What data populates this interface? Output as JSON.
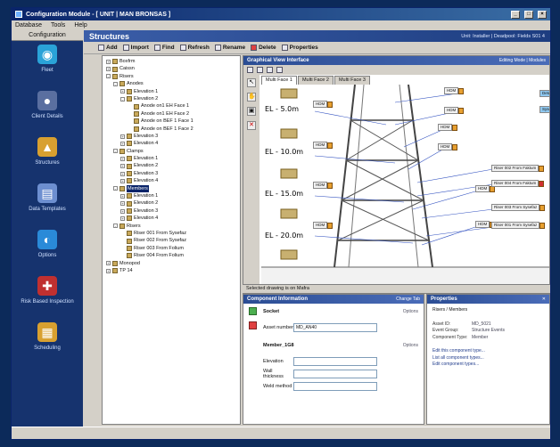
{
  "window": {
    "title": "Configuration Module - [ UNIT | MAN BRONSAS ]",
    "controls": [
      "_",
      "□",
      "×"
    ]
  },
  "menu": [
    "Database",
    "Tools",
    "Help"
  ],
  "nav": {
    "header": "Configuration",
    "items": [
      {
        "label": "Fleet",
        "icon": "globe-icon",
        "color": "#2aa3d8",
        "glyph": "◉"
      },
      {
        "label": "Client Details",
        "icon": "person-icon",
        "color": "#5a6fa0",
        "glyph": "●"
      },
      {
        "label": "Structures",
        "icon": "platform-icon",
        "color": "#d8a030",
        "glyph": "▲"
      },
      {
        "label": "Data Templates",
        "icon": "document-icon",
        "color": "#6d8fd0",
        "glyph": "▤"
      },
      {
        "label": "Options",
        "icon": "options-icon",
        "color": "#2a8ad8",
        "glyph": "◐"
      },
      {
        "label": "Risk Based Inspection",
        "icon": "risk-icon",
        "color": "#c03030",
        "glyph": "✚"
      },
      {
        "label": "Scheduling",
        "icon": "calendar-icon",
        "color": "#d8a030",
        "glyph": "▦"
      }
    ]
  },
  "structures": {
    "title": "Structures",
    "meta": "Unit: Installer | Deadpool: Fields S01 4"
  },
  "toolbar": [
    "Add",
    "Import",
    "Find",
    "Refresh",
    "Rename",
    "Delete",
    "Properties"
  ],
  "tree": [
    {
      "indent": 0,
      "box": "+",
      "label": "Boxfrm"
    },
    {
      "indent": 0,
      "box": "+",
      "label": "Caissn"
    },
    {
      "indent": 0,
      "box": "-",
      "label": "Risers"
    },
    {
      "indent": 1,
      "box": "-",
      "label": "Anodes"
    },
    {
      "indent": 2,
      "box": "+",
      "label": "Elevation 1"
    },
    {
      "indent": 2,
      "box": "-",
      "label": "Elevation 2"
    },
    {
      "indent": 3,
      "box": "",
      "label": "Anode on1 EH Face 1"
    },
    {
      "indent": 3,
      "box": "",
      "label": "Anode on1 EH Face 2"
    },
    {
      "indent": 3,
      "box": "",
      "label": "Anode on BEF 1 Face 1"
    },
    {
      "indent": 3,
      "box": "",
      "label": "Anode on BEF 1 Face 2"
    },
    {
      "indent": 2,
      "box": "+",
      "label": "Elevation 3"
    },
    {
      "indent": 2,
      "box": "+",
      "label": "Elevation 4"
    },
    {
      "indent": 1,
      "box": "-",
      "label": "Clamps"
    },
    {
      "indent": 2,
      "box": "+",
      "label": "Elevation 1"
    },
    {
      "indent": 2,
      "box": "+",
      "label": "Elevation 2"
    },
    {
      "indent": 2,
      "box": "+",
      "label": "Elevation 3"
    },
    {
      "indent": 2,
      "box": "+",
      "label": "Elevation 4"
    },
    {
      "indent": 1,
      "box": "-",
      "label": "Members",
      "selected": true
    },
    {
      "indent": 2,
      "box": "+",
      "label": "Elevation 1"
    },
    {
      "indent": 2,
      "box": "+",
      "label": "Elevation 2"
    },
    {
      "indent": 2,
      "box": "+",
      "label": "Elevation 3"
    },
    {
      "indent": 2,
      "box": "+",
      "label": "Elevation 4"
    },
    {
      "indent": 1,
      "box": "-",
      "label": "Risers"
    },
    {
      "indent": 2,
      "box": "",
      "label": "Riser 001 From Sysefaz"
    },
    {
      "indent": 2,
      "box": "",
      "label": "Riser 002 From Sysefaz"
    },
    {
      "indent": 2,
      "box": "",
      "label": "Riser 003 From Folium"
    },
    {
      "indent": 2,
      "box": "",
      "label": "Riser 004 From Folium"
    },
    {
      "indent": 0,
      "box": "+",
      "label": "Monopod"
    },
    {
      "indent": 0,
      "box": "+",
      "label": "TP 14"
    }
  ],
  "graphic": {
    "title": "Graphical View Interface",
    "title_right": "Editing Mode | Modules",
    "tabs": [
      "Multi Face 1",
      "Multi Face 2",
      "Multi Face 3"
    ],
    "elevations": [
      "EL - 5.0m",
      "EL - 10.0m",
      "EL - 15.0m",
      "EL - 20.0m"
    ],
    "tags_left": [
      "HDM",
      "HDM",
      "HDM",
      "HDM"
    ],
    "tags_mid": [
      "HDM",
      "HDM",
      "HDM",
      "HDM",
      "HDM",
      "HDM"
    ],
    "tags_right": [
      "Riser 002 From Faktum",
      "Riser 004 From Faktum",
      "Riser 003 From Sysefaz",
      "Riser 001 From Sysefaz"
    ],
    "detail_buttons": [
      "Detail",
      "Sysefaz"
    ],
    "status": "Selected drawing is on Mafra"
  },
  "component": {
    "title": "Component Information",
    "title_right": "Change Tab",
    "socket_label": "Socket",
    "options": "Options",
    "asset_number_label": "Asset number",
    "asset_number_value": "MD_AN40",
    "member_label": "Member_1G8",
    "fields": [
      "Elevation",
      "Wall thickness",
      "Weld method"
    ]
  },
  "properties": {
    "title": "Properties",
    "path": "Risers / Members",
    "rows": [
      {
        "k": "Asset ID:",
        "v": "MD_5021"
      },
      {
        "k": "Event Group:",
        "v": "Structure Events"
      },
      {
        "k": "Component Type:",
        "v": "Member"
      }
    ],
    "links": [
      "Edit this component type...",
      "List all component types...",
      "Edit component types..."
    ]
  }
}
